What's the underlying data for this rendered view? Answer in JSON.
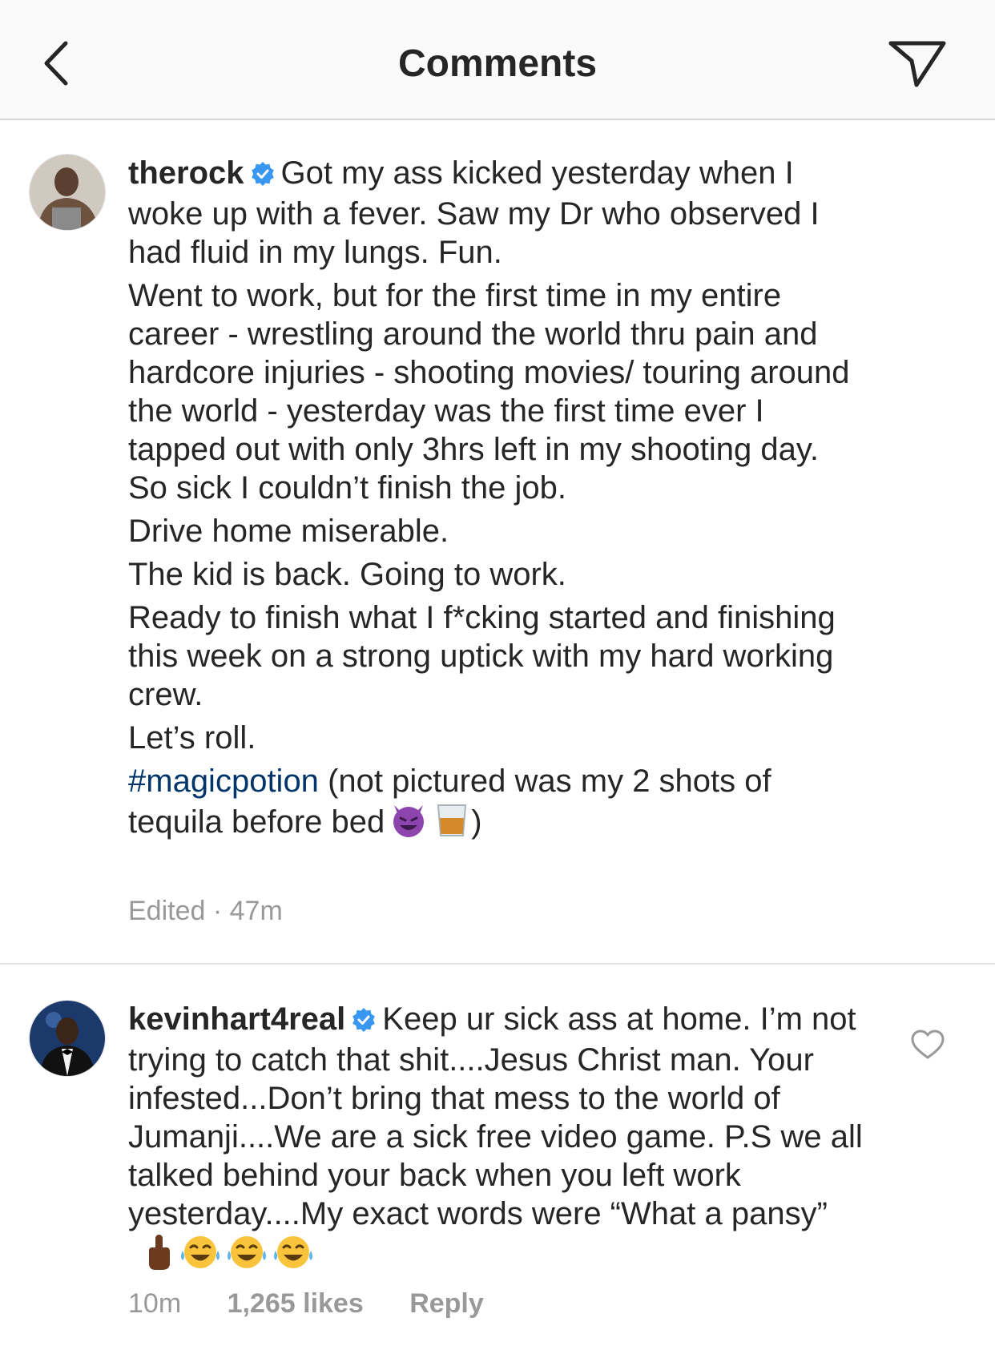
{
  "header": {
    "title": "Comments",
    "back_icon": "chevron-left-icon",
    "share_icon": "paper-plane-icon"
  },
  "caption": {
    "username": "therock",
    "verified": true,
    "paragraphs": [
      "Got my ass kicked yesterday when I woke up with a fever. Saw my Dr who observed I had fluid in my lungs. Fun.",
      "Went to work, but for the first time in my entire career - wrestling around the world thru pain and hardcore injuries - shooting movies/ touring around the world - yesterday was the first time ever I tapped out with only 3hrs left in my shooting day. So sick I couldn’t finish the job.",
      "Drive home miserable.",
      "The kid is back. Going to work.",
      "Ready to finish what I f*cking started and finishing this week on a strong uptick with my hard working crew.",
      "Let’s roll."
    ],
    "hashtag": "#magicpotion",
    "last_text": "(not pictured was my 2 shots of tequila before bed",
    "last_close": ")",
    "last_emojis": [
      "smiling-devil-emoji",
      "tumbler-glass-emoji"
    ],
    "meta": "Edited · 47m"
  },
  "comment": {
    "username": "kevinhart4real",
    "verified": true,
    "text": "Keep ur sick ass at home. I’m not trying to catch that shit....Jesus Christ man. Your infested...Don’t bring that mess to the world of Jumanji....We are a sick free video game. P.S we all talked behind your back when you left work yesterday....My exact words were “What a pansy”",
    "emojis": [
      "middle-finger-emoji",
      "tears-of-joy-emoji",
      "tears-of-joy-emoji",
      "tears-of-joy-emoji"
    ],
    "time": "10m",
    "likes": "1,265 likes",
    "reply": "Reply"
  },
  "colors": {
    "verified_blue": "#3897f0",
    "hashtag": "#003569",
    "meta_gray": "#999999",
    "text": "#262626"
  }
}
